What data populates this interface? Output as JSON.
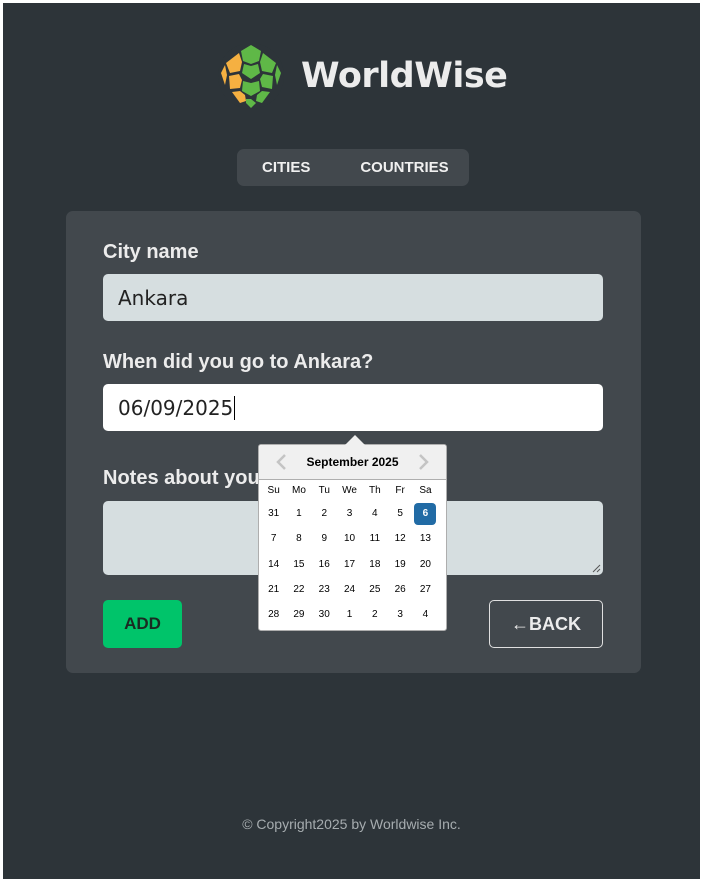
{
  "brand": {
    "name": "WorldWise"
  },
  "tabs": [
    {
      "label": "CITIES"
    },
    {
      "label": "COUNTRIES"
    }
  ],
  "form": {
    "city_label": "City name",
    "city_value": "Ankara",
    "date_label": "When did you go to Ankara?",
    "date_value": "06/09/2025",
    "notes_label": "Notes about your trip to Ankara",
    "notes_value": "",
    "add_label": "ADD",
    "back_label": "←BACK"
  },
  "datepicker": {
    "title": "September 2025",
    "weekdays": [
      "Su",
      "Mo",
      "Tu",
      "We",
      "Th",
      "Fr",
      "Sa"
    ],
    "weeks": [
      [
        "31",
        "1",
        "2",
        "3",
        "4",
        "5",
        "6"
      ],
      [
        "7",
        "8",
        "9",
        "10",
        "11",
        "12",
        "13"
      ],
      [
        "14",
        "15",
        "16",
        "17",
        "18",
        "19",
        "20"
      ],
      [
        "21",
        "22",
        "23",
        "24",
        "25",
        "26",
        "27"
      ],
      [
        "28",
        "29",
        "30",
        "1",
        "2",
        "3",
        "4"
      ]
    ],
    "selected": "6",
    "icons": {
      "prev": "chevron-left-icon",
      "next": "chevron-right-icon"
    }
  },
  "footer": {
    "text": "© Copyright2025 by Worldwise Inc."
  },
  "colors": {
    "background": "#2d3439",
    "card": "#42484d",
    "accent_green": "#00c46a",
    "selected_day": "#216ba5"
  }
}
